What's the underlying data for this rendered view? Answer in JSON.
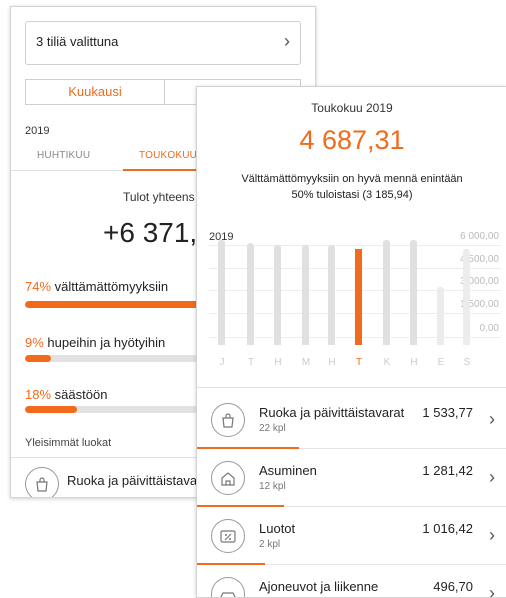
{
  "back": {
    "accounts_selector": "3 tiliä valittuna",
    "period_tabs": [
      "Kuukausi"
    ],
    "year": "2019",
    "months": [
      "HUHTIKUU",
      "TOUKOKUU"
    ],
    "income_label": "Tulot yhteens",
    "income_value": "+6 371,",
    "allocations": [
      {
        "pct": "74%",
        "label": "välttämättömyyksiin",
        "fill": 0.74
      },
      {
        "pct": "9%",
        "label": "hupeihin ja hyötyihin",
        "fill": 0.09
      },
      {
        "pct": "18%",
        "label": "säästöön",
        "fill": 0.18
      }
    ],
    "section_title": "Yleisimmät luokat",
    "partial_category": "Ruoka ja päivittäistava"
  },
  "front": {
    "title": "Toukokuu 2019",
    "amount": "4 687,31",
    "note": "Välttämättömyyksiin on hyvä mennä enintään 50% tuloistasi (3 185,94)",
    "chart_year": "2019",
    "chart_data": {
      "type": "bar",
      "categories": [
        "J",
        "T",
        "H",
        "M",
        "H",
        "T",
        "K",
        "H",
        "E",
        "S"
      ],
      "values": [
        4900,
        4800,
        4700,
        4700,
        4700,
        4500,
        4900,
        4900,
        2700,
        4500
      ],
      "highlight_index": 5,
      "y_ticks": [
        "6 000,00",
        "4 500,00",
        "3 000,00",
        "1 500,00",
        "0,00"
      ],
      "ylim": [
        0,
        6000
      ]
    },
    "categories": [
      {
        "name": "Ruoka ja päivittäistavarat",
        "count": "22 kpl",
        "amount": "1 533,77",
        "icon": "groceries-bag-icon",
        "share": 0.33
      },
      {
        "name": "Asuminen",
        "count": "12 kpl",
        "amount": "1 281,42",
        "icon": "house-icon",
        "share": 0.28
      },
      {
        "name": "Luotot",
        "count": "2 kpl",
        "amount": "1 016,42",
        "icon": "percent-card-icon",
        "share": 0.22
      },
      {
        "name": "Ajoneuvot ja liikenne",
        "count": "1 kpl",
        "amount": "496,70",
        "icon": "car-icon",
        "share": 0.11
      }
    ]
  },
  "colors": {
    "accent": "#f26a1b",
    "bar": "#e0e0e0"
  }
}
